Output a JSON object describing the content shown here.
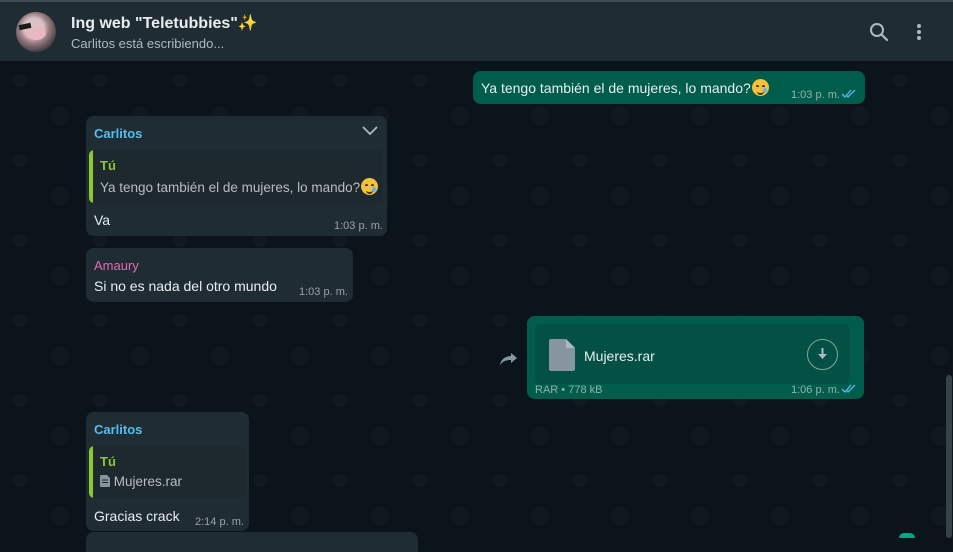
{
  "header": {
    "title": "Ing web \"Teletubbies\"✨",
    "status": "Carlitos está escribiendo..."
  },
  "messages": [
    {
      "direction": "outgoing",
      "text": "Ya tengo también el de mujeres, lo mando?",
      "emoji": "smiling-face-with-tear",
      "time": "1:03 p. m.",
      "status": "read"
    },
    {
      "direction": "incoming",
      "sender": "Carlitos",
      "sender_color": "#53bdeb",
      "quote": {
        "author": "Tú",
        "text": "Ya tengo también el de mujeres, lo mando?",
        "emoji": "smiling-face-with-tear"
      },
      "text": "Va",
      "time": "1:03 p. m."
    },
    {
      "direction": "incoming",
      "sender": "Amaury",
      "sender_color": "#e26ab6",
      "text": "Si no es nada del otro mundo",
      "time": "1:03 p. m."
    },
    {
      "direction": "outgoing",
      "file": {
        "name": "Mujeres.rar",
        "type": "RAR",
        "separator": "•",
        "size": "778 kB"
      },
      "time": "1:06 p. m.",
      "status": "read"
    },
    {
      "direction": "incoming",
      "sender": "Carlitos",
      "sender_color": "#53bdeb",
      "quote": {
        "author": "Tú",
        "text": "Mujeres.rar",
        "icon": "document-icon"
      },
      "text": "Gracias crack",
      "time": "2:14 p. m."
    }
  ],
  "colors": {
    "outgoing_bubble": "#005c4b",
    "incoming_bubble": "#202c33",
    "background": "#0b141a",
    "header": "#202c33",
    "read_ticks": "#53bdeb",
    "quote_accent": "#8fc82a"
  },
  "icons": {
    "search": "search-icon",
    "menu": "more-vertical-icon",
    "forward": "forward-icon",
    "download": "download-icon",
    "chevron": "chevron-down-icon"
  }
}
